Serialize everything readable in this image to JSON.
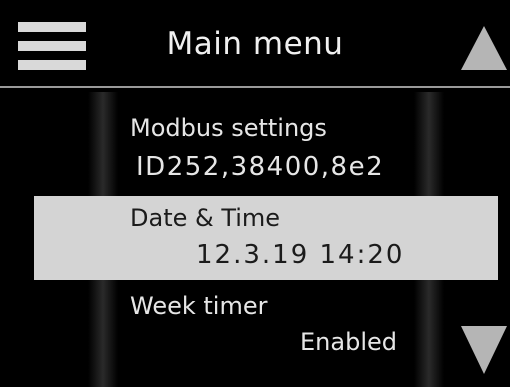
{
  "header": {
    "menu_icon": "hamburger-menu-icon",
    "title": "Main menu",
    "up_icon": "arrow-up-icon"
  },
  "menu": {
    "items": [
      {
        "label": "Modbus settings",
        "value": "ID252,38400,8e2",
        "selected": false
      },
      {
        "label": "Date & Time",
        "value": "12.3.19 14:20",
        "selected": true
      },
      {
        "label": "Week timer",
        "value": "Enabled",
        "selected": false
      }
    ]
  },
  "footer": {
    "down_icon": "arrow-down-icon"
  },
  "colors": {
    "background": "#000000",
    "text": "#e6e6e6",
    "selection": "#d4d4d4",
    "arrow": "#b5b5b5"
  }
}
